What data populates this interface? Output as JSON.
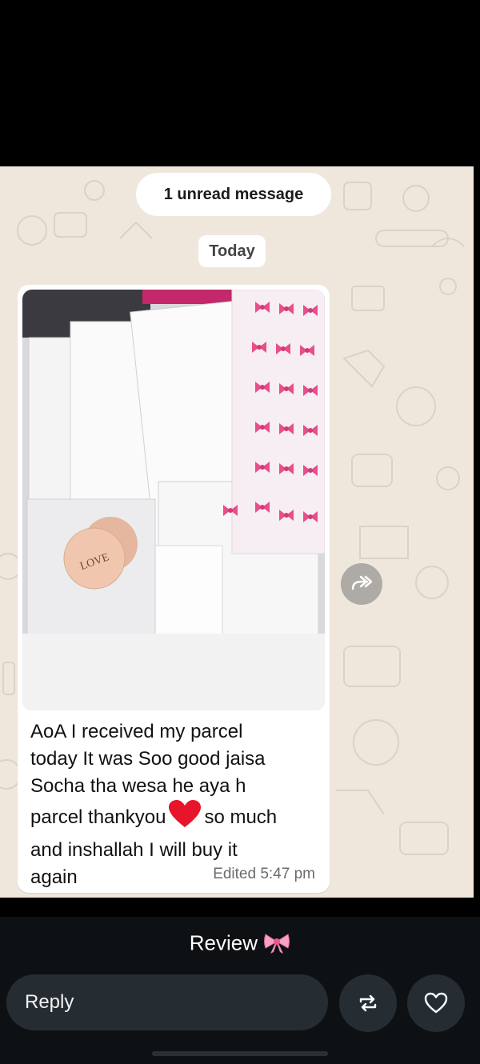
{
  "chat": {
    "unread_banner": "1 unread message",
    "date_chip": "Today",
    "message": {
      "line1": "AoA I received my parcel",
      "line2": "today It was Soo good jaisa",
      "line3": "Socha tha wesa he aya h",
      "line4a": "parcel thankyou",
      "emoji": "red-heart",
      "line4b": "so much",
      "line5": "and inshallah I will buy it",
      "line6": "again",
      "time": "Edited 5:47 pm",
      "photo": {
        "label": "photo of parcel packaging: clear pouches, pink bow-print pouches, and round stickers",
        "sticker_text": "LOVE"
      }
    },
    "forward_icon": "forward-arrow-icon"
  },
  "story": {
    "caption": "Review",
    "caption_emoji": "ribbon-bow",
    "reply_placeholder": "Reply",
    "repost_icon": "repost-icon",
    "like_icon": "heart-outline-icon"
  },
  "colors": {
    "chat_background": "#efe7dc",
    "bubble": "#ffffff",
    "bottom_bar": "#0d1114",
    "field": "#252d33",
    "heart": "#e8152a",
    "bow_pink": "#e94d8a"
  }
}
